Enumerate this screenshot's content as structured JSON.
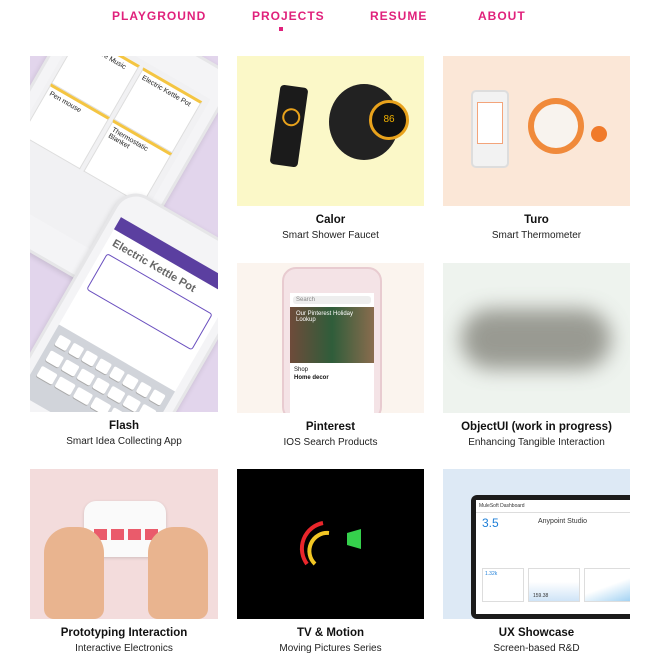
{
  "nav": {
    "playground": "PLAYGROUND",
    "projects": "PROJECTS",
    "resume": "RESUME",
    "about": "ABOUT"
  },
  "colors": {
    "accent": "#e0217c"
  },
  "projects": [
    {
      "title": "Flash",
      "subtitle": "Smart Idea Collecting App",
      "thumb": {
        "screen_title": "Electric Kettle Pot",
        "cards": [
          "Interactive Music Box",
          "Electric Kettle Pot",
          "Pen mouse",
          "Thermostatic Blanket"
        ]
      }
    },
    {
      "title": "Calor",
      "subtitle": "Smart Shower Faucet",
      "thumb": {
        "display": "86"
      }
    },
    {
      "title": "Turo",
      "subtitle": "Smart Thermometer"
    },
    {
      "title": "Pinterest",
      "subtitle": "IOS Search Products",
      "thumb": {
        "search_placeholder": "Search",
        "banner": "Our Pinterest Holiday Lookup",
        "section": "Shop",
        "category": "Home decor"
      }
    },
    {
      "title": "ObjectUI (work in progress)",
      "subtitle": "Enhancing Tangible Interaction"
    },
    {
      "title": "Prototyping Interaction",
      "subtitle": "Interactive Electronics"
    },
    {
      "title": "TV & Motion",
      "subtitle": "Moving Pictures Series"
    },
    {
      "title": "UX Showcase",
      "subtitle": "Screen-based R&D",
      "thumb": {
        "app": "MuleSoft Dashboard",
        "metric": "3.5",
        "heading": "Anypoint Studio",
        "stat1": "1.32k",
        "stat2": "159.38"
      }
    }
  ]
}
